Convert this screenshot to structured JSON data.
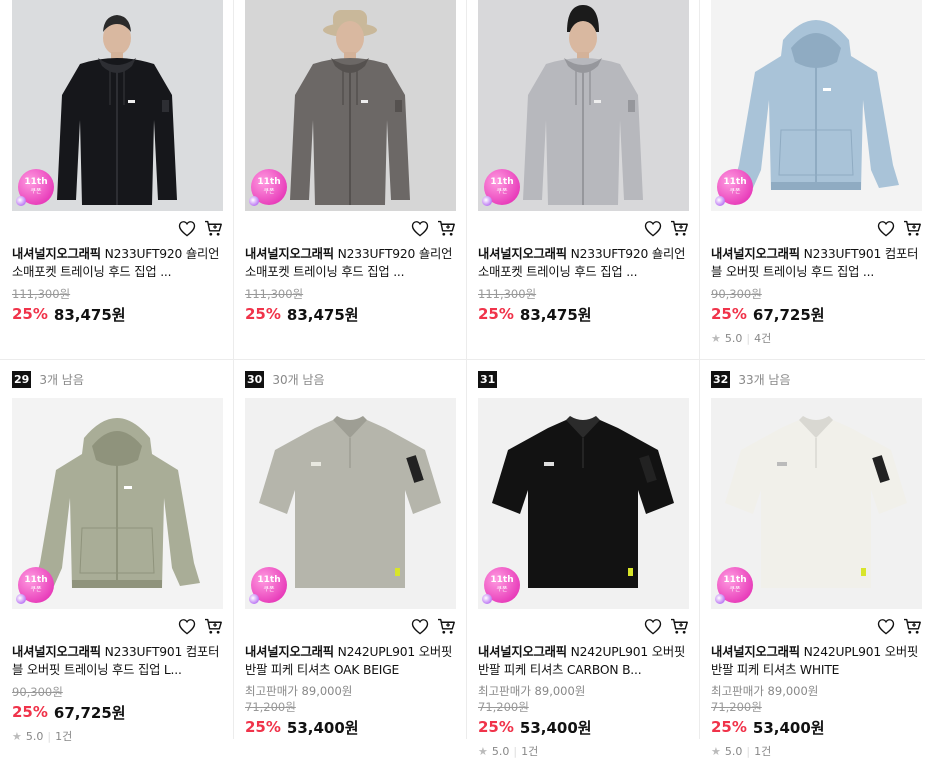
{
  "badge": {
    "top": "11th",
    "bottom": "쿠폰"
  },
  "row1": [
    {
      "brand": "내셔널지오그래픽",
      "name": "N233UFT920 숄리언 소매포켓 트레이닝 후드 집업 ...",
      "original": "111,300원",
      "discount": "25%",
      "price": "83,475원",
      "image": "black hoodie zip-up on model",
      "bg": "#dadcde"
    },
    {
      "brand": "내셔널지오그래픽",
      "name": "N233UFT920 숄리언 소매포켓 트레이닝 후드 집업 ...",
      "original": "111,300원",
      "discount": "25%",
      "price": "83,475원",
      "image": "charcoal grey zip-up on model with bucket hat",
      "bg": "#d6d6d6"
    },
    {
      "brand": "내셔널지오그래픽",
      "name": "N233UFT920 숄리언 소매포켓 트레이닝 후드 집업 ...",
      "original": "111,300원",
      "discount": "25%",
      "price": "83,475원",
      "image": "light grey zip-up on model with beanie",
      "bg": "#d8d8da"
    },
    {
      "brand": "내셔널지오그래픽",
      "name": "N233UFT901 컴포터블 오버핏 트레이닝 후드 집업 ...",
      "original": "90,300원",
      "discount": "25%",
      "price": "67,725원",
      "rating": "5.0",
      "reviews": "4건",
      "image": "light blue hoodie zip-up",
      "bg": "#f3f3f3"
    }
  ],
  "row2": [
    {
      "rank": "29",
      "stock": "3개 남음",
      "brand": "내셔널지오그래픽",
      "name": "N233UFT901 컴포터블 오버핏 트레이닝 후드 집업 L...",
      "original": "90,300원",
      "discount": "25%",
      "price": "67,725원",
      "rating": "5.0",
      "reviews": "1건",
      "image": "olive khaki hoodie zip-up",
      "bg": "#f3f3f3"
    },
    {
      "rank": "30",
      "stock": "30개 남음",
      "brand": "내셔널지오그래픽",
      "name": "N242UPL901 오버핏 반팔 피케 티셔츠 OAK BEIGE",
      "lowest": "최고판매가 89,000원",
      "original": "71,200원",
      "discount": "25%",
      "price": "53,400원",
      "image": "beige polo shirt",
      "bg": "#f1f1f1"
    },
    {
      "rank": "31",
      "stock": "",
      "brand": "내셔널지오그래픽",
      "name": "N242UPL901 오버핏 반팔 피케 티셔츠 CARBON B...",
      "lowest": "최고판매가 89,000원",
      "original": "71,200원",
      "discount": "25%",
      "price": "53,400원",
      "rating": "5.0",
      "reviews": "1건",
      "image": "black polo shirt",
      "bg": "#f1f1f1"
    },
    {
      "rank": "32",
      "stock": "33개 남음",
      "brand": "내셔널지오그래픽",
      "name": "N242UPL901 오버핏 반팔 피케 티셔츠 WHITE",
      "lowest": "최고판매가 89,000원",
      "original": "71,200원",
      "discount": "25%",
      "price": "53,400원",
      "rating": "5.0",
      "reviews": "1건",
      "image": "white polo shirt",
      "bg": "#f1f1f1"
    }
  ]
}
